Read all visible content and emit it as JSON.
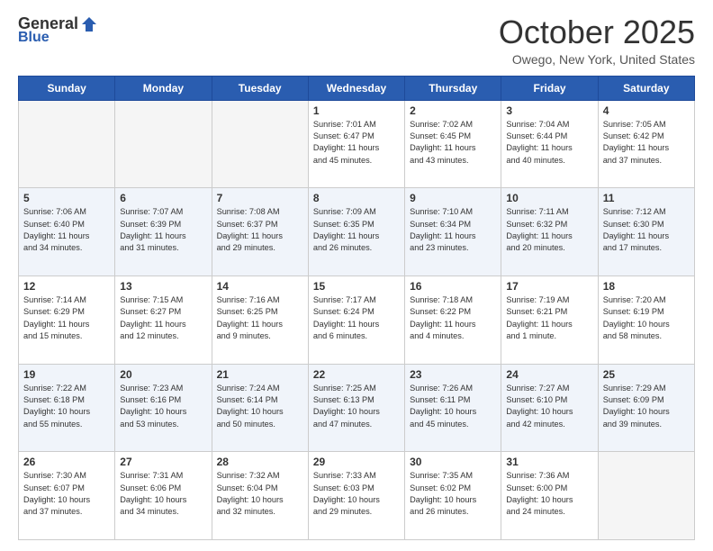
{
  "header": {
    "logo_general": "General",
    "logo_blue": "Blue",
    "month_title": "October 2025",
    "location": "Owego, New York, United States"
  },
  "days_of_week": [
    "Sunday",
    "Monday",
    "Tuesday",
    "Wednesday",
    "Thursday",
    "Friday",
    "Saturday"
  ],
  "weeks": [
    {
      "row_class": "cal-row-1",
      "days": [
        {
          "num": "",
          "info": ""
        },
        {
          "num": "",
          "info": ""
        },
        {
          "num": "",
          "info": ""
        },
        {
          "num": "1",
          "info": "Sunrise: 7:01 AM\nSunset: 6:47 PM\nDaylight: 11 hours\nand 45 minutes."
        },
        {
          "num": "2",
          "info": "Sunrise: 7:02 AM\nSunset: 6:45 PM\nDaylight: 11 hours\nand 43 minutes."
        },
        {
          "num": "3",
          "info": "Sunrise: 7:04 AM\nSunset: 6:44 PM\nDaylight: 11 hours\nand 40 minutes."
        },
        {
          "num": "4",
          "info": "Sunrise: 7:05 AM\nSunset: 6:42 PM\nDaylight: 11 hours\nand 37 minutes."
        }
      ]
    },
    {
      "row_class": "cal-row-2",
      "days": [
        {
          "num": "5",
          "info": "Sunrise: 7:06 AM\nSunset: 6:40 PM\nDaylight: 11 hours\nand 34 minutes."
        },
        {
          "num": "6",
          "info": "Sunrise: 7:07 AM\nSunset: 6:39 PM\nDaylight: 11 hours\nand 31 minutes."
        },
        {
          "num": "7",
          "info": "Sunrise: 7:08 AM\nSunset: 6:37 PM\nDaylight: 11 hours\nand 29 minutes."
        },
        {
          "num": "8",
          "info": "Sunrise: 7:09 AM\nSunset: 6:35 PM\nDaylight: 11 hours\nand 26 minutes."
        },
        {
          "num": "9",
          "info": "Sunrise: 7:10 AM\nSunset: 6:34 PM\nDaylight: 11 hours\nand 23 minutes."
        },
        {
          "num": "10",
          "info": "Sunrise: 7:11 AM\nSunset: 6:32 PM\nDaylight: 11 hours\nand 20 minutes."
        },
        {
          "num": "11",
          "info": "Sunrise: 7:12 AM\nSunset: 6:30 PM\nDaylight: 11 hours\nand 17 minutes."
        }
      ]
    },
    {
      "row_class": "cal-row-3",
      "days": [
        {
          "num": "12",
          "info": "Sunrise: 7:14 AM\nSunset: 6:29 PM\nDaylight: 11 hours\nand 15 minutes."
        },
        {
          "num": "13",
          "info": "Sunrise: 7:15 AM\nSunset: 6:27 PM\nDaylight: 11 hours\nand 12 minutes."
        },
        {
          "num": "14",
          "info": "Sunrise: 7:16 AM\nSunset: 6:25 PM\nDaylight: 11 hours\nand 9 minutes."
        },
        {
          "num": "15",
          "info": "Sunrise: 7:17 AM\nSunset: 6:24 PM\nDaylight: 11 hours\nand 6 minutes."
        },
        {
          "num": "16",
          "info": "Sunrise: 7:18 AM\nSunset: 6:22 PM\nDaylight: 11 hours\nand 4 minutes."
        },
        {
          "num": "17",
          "info": "Sunrise: 7:19 AM\nSunset: 6:21 PM\nDaylight: 11 hours\nand 1 minute."
        },
        {
          "num": "18",
          "info": "Sunrise: 7:20 AM\nSunset: 6:19 PM\nDaylight: 10 hours\nand 58 minutes."
        }
      ]
    },
    {
      "row_class": "cal-row-4",
      "days": [
        {
          "num": "19",
          "info": "Sunrise: 7:22 AM\nSunset: 6:18 PM\nDaylight: 10 hours\nand 55 minutes."
        },
        {
          "num": "20",
          "info": "Sunrise: 7:23 AM\nSunset: 6:16 PM\nDaylight: 10 hours\nand 53 minutes."
        },
        {
          "num": "21",
          "info": "Sunrise: 7:24 AM\nSunset: 6:14 PM\nDaylight: 10 hours\nand 50 minutes."
        },
        {
          "num": "22",
          "info": "Sunrise: 7:25 AM\nSunset: 6:13 PM\nDaylight: 10 hours\nand 47 minutes."
        },
        {
          "num": "23",
          "info": "Sunrise: 7:26 AM\nSunset: 6:11 PM\nDaylight: 10 hours\nand 45 minutes."
        },
        {
          "num": "24",
          "info": "Sunrise: 7:27 AM\nSunset: 6:10 PM\nDaylight: 10 hours\nand 42 minutes."
        },
        {
          "num": "25",
          "info": "Sunrise: 7:29 AM\nSunset: 6:09 PM\nDaylight: 10 hours\nand 39 minutes."
        }
      ]
    },
    {
      "row_class": "cal-row-5",
      "days": [
        {
          "num": "26",
          "info": "Sunrise: 7:30 AM\nSunset: 6:07 PM\nDaylight: 10 hours\nand 37 minutes."
        },
        {
          "num": "27",
          "info": "Sunrise: 7:31 AM\nSunset: 6:06 PM\nDaylight: 10 hours\nand 34 minutes."
        },
        {
          "num": "28",
          "info": "Sunrise: 7:32 AM\nSunset: 6:04 PM\nDaylight: 10 hours\nand 32 minutes."
        },
        {
          "num": "29",
          "info": "Sunrise: 7:33 AM\nSunset: 6:03 PM\nDaylight: 10 hours\nand 29 minutes."
        },
        {
          "num": "30",
          "info": "Sunrise: 7:35 AM\nSunset: 6:02 PM\nDaylight: 10 hours\nand 26 minutes."
        },
        {
          "num": "31",
          "info": "Sunrise: 7:36 AM\nSunset: 6:00 PM\nDaylight: 10 hours\nand 24 minutes."
        },
        {
          "num": "",
          "info": ""
        }
      ]
    }
  ]
}
